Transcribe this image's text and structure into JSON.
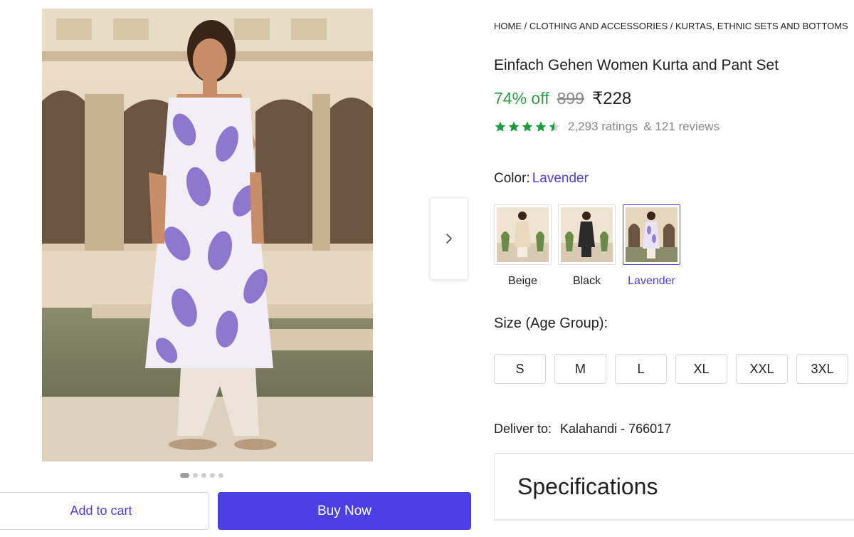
{
  "breadcrumb": "HOME / CLOTHING AND ACCESSORIES / KURTAS, ETHNIC SETS AND BOTTOMS",
  "product": {
    "title": "Einfach Gehen Women Kurta and Pant Set",
    "discount": "74% off",
    "mrp": "899",
    "price": "₹228",
    "rating_stars": 4.5,
    "ratings_count": "2,293 ratings",
    "reviews_count": "& 121 reviews"
  },
  "color": {
    "label": "Color:",
    "selected": "Lavender",
    "options": [
      {
        "label": "Beige",
        "swatch": "#ead7bd"
      },
      {
        "label": "Black",
        "swatch": "#2b2b2b"
      },
      {
        "label": "Lavender",
        "swatch": "#8f7fd6"
      }
    ]
  },
  "size": {
    "heading": "Size (Age Group):",
    "options": [
      "S",
      "M",
      "L",
      "XL",
      "XXL",
      "3XL"
    ]
  },
  "delivery": {
    "label": "Deliver to:",
    "location": "Kalahandi - 766017"
  },
  "specifications": {
    "title": "Specifications"
  },
  "carousel": {
    "slide_count": 5,
    "active_index": 0
  },
  "actions": {
    "add_to_cart": "Add to cart",
    "buy_now": "Buy Now"
  },
  "icons": {
    "next": "chevron-right-icon",
    "star": "star-icon"
  },
  "colors": {
    "accent": "#4b3fe6",
    "discount_green": "#2f9e44",
    "star_green": "#1b9a3e",
    "muted_grey": "#878787"
  }
}
